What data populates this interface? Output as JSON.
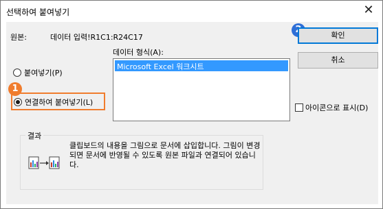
{
  "window": {
    "title": "선택하여 붙여넣기",
    "close_glyph": "✕"
  },
  "source": {
    "label": "원본:",
    "value": "데이터 입력!R1C1:R24C17"
  },
  "format": {
    "label": "데이터 형식(A):",
    "items": [
      "Microsoft Excel 워크시트"
    ]
  },
  "options": {
    "paste_label": "붙여넣기(P)",
    "paste_link_label": "연결하여 붙여넣기(L)",
    "selected": "paste_link"
  },
  "buttons": {
    "ok": "확인",
    "cancel": "취소"
  },
  "display_as_icon": {
    "label": "아이콘으로 표시(D)",
    "checked": false
  },
  "result": {
    "title": "결과",
    "text": "클립보드의 내용을 그림으로 문서에 삽입합니다. 그림이 변경되면 문서에 반영될 수 있도록 원본 파일과 연결되어 있습니다."
  },
  "annotations": {
    "badge1": "1",
    "badge2": "2"
  },
  "colors": {
    "highlight_orange": "#f07c2d",
    "badge_blue": "#2f6fd7",
    "selection_blue": "#3399ff"
  }
}
